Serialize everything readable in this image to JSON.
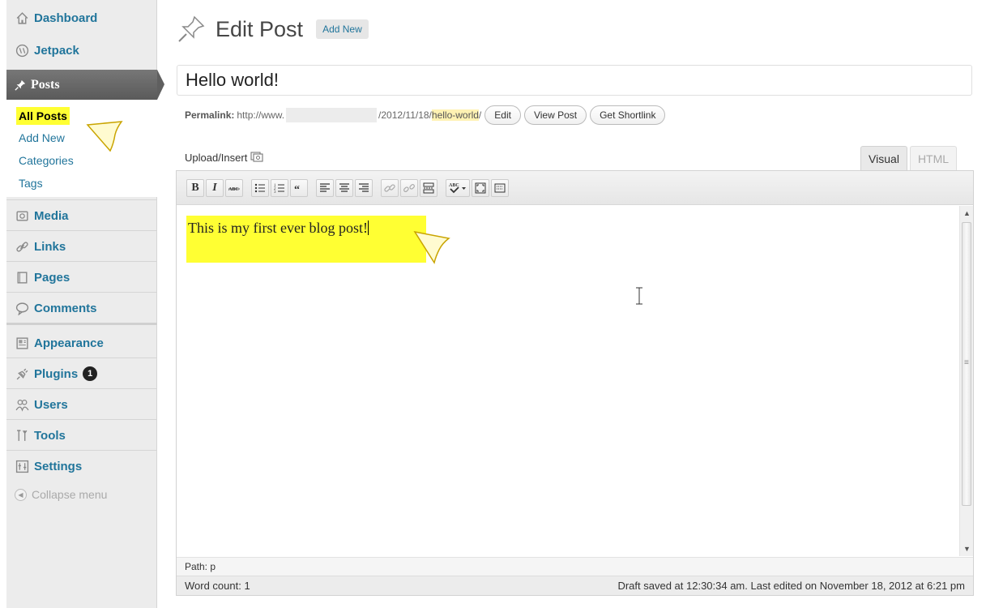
{
  "sidebar": {
    "dashboard": "Dashboard",
    "jetpack": "Jetpack",
    "posts": "Posts",
    "submenu": {
      "all_posts": "All Posts",
      "add_new": "Add New",
      "categories": "Categories",
      "tags": "Tags"
    },
    "media": "Media",
    "links": "Links",
    "pages": "Pages",
    "comments": "Comments",
    "appearance": "Appearance",
    "plugins": "Plugins",
    "plugins_badge": "1",
    "users": "Users",
    "tools": "Tools",
    "settings": "Settings",
    "collapse": "Collapse menu"
  },
  "header": {
    "title": "Edit Post",
    "add_new": "Add New"
  },
  "post": {
    "title": "Hello world!",
    "permalink_label": "Permalink:",
    "permalink_prefix": "http://www.",
    "permalink_date": "/2012/11/18/",
    "permalink_slug": "hello-world",
    "permalink_end": "/",
    "content": "This is my first ever blog post!"
  },
  "permalink_buttons": {
    "edit": "Edit",
    "view": "View Post",
    "shortlink": "Get Shortlink"
  },
  "editor": {
    "upload_insert": "Upload/Insert",
    "tab_visual": "Visual",
    "tab_html": "HTML",
    "bold_label": "B",
    "italic_label": "I",
    "path": "Path: p",
    "word_count": "Word count: 1",
    "draft_status": "Draft saved at 12:30:34 am. Last edited on November 18, 2012 at 6:21 pm"
  },
  "colors": {
    "link": "#21759b",
    "highlight": "#ffff33",
    "active_menu": "#666666"
  }
}
